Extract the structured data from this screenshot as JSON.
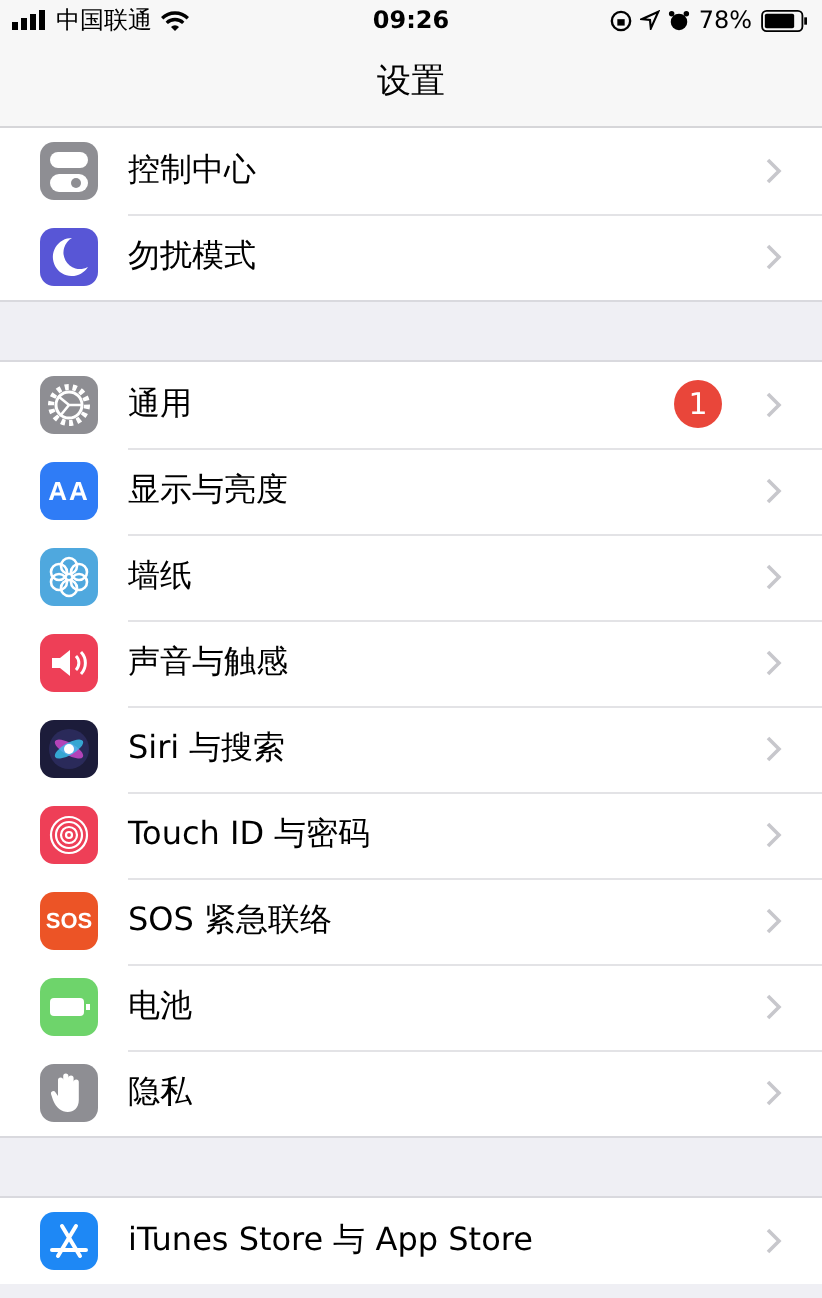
{
  "status_bar": {
    "carrier": "中国联通",
    "time": "09:26",
    "battery": "78%"
  },
  "nav": {
    "title": "设置"
  },
  "groups": [
    {
      "items": [
        {
          "kind": "control",
          "label": "控制中心"
        },
        {
          "kind": "moon",
          "label": "勿扰模式"
        }
      ]
    },
    {
      "items": [
        {
          "kind": "gear",
          "label": "通用",
          "badge": "1"
        },
        {
          "kind": "display",
          "label": "显示与亮度",
          "icon_text": "AA"
        },
        {
          "kind": "wallpaper",
          "label": "墙纸"
        },
        {
          "kind": "sound",
          "label": "声音与触感"
        },
        {
          "kind": "siri",
          "label": "Siri 与搜索"
        },
        {
          "kind": "touchid",
          "label": "Touch ID 与密码"
        },
        {
          "kind": "sos",
          "label": "SOS 紧急联络",
          "icon_text": "SOS"
        },
        {
          "kind": "battery",
          "label": "电池"
        },
        {
          "kind": "privacy",
          "label": "隐私"
        }
      ]
    },
    {
      "items": [
        {
          "kind": "appstore",
          "label": "iTunes Store 与 App Store"
        }
      ]
    }
  ]
}
